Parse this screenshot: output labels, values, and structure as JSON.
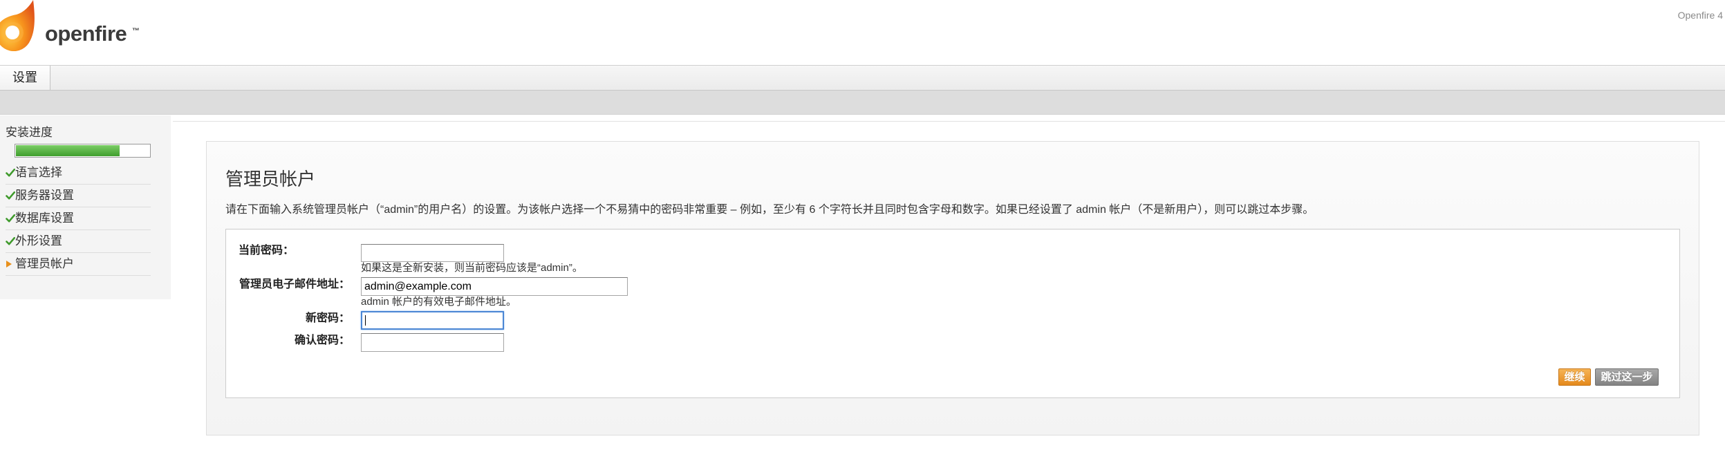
{
  "app": {
    "logo_text": "openfire",
    "logo_tm": "™",
    "version_text": "Openfire 4"
  },
  "tabs": [
    {
      "label": "设置"
    }
  ],
  "sidebar": {
    "progress_label": "安装进度",
    "progress_percent": 78,
    "steps": [
      {
        "label": "语言选择",
        "icon": "checkmark-icon"
      },
      {
        "label": "服务器设置",
        "icon": "checkmark-icon"
      },
      {
        "label": "数据库设置",
        "icon": "checkmark-icon"
      },
      {
        "label": "外形设置",
        "icon": "checkmark-icon"
      },
      {
        "label": "管理员帐户",
        "icon": "arrow-right-icon"
      }
    ]
  },
  "main": {
    "title": "管理员帐户",
    "description": "请在下面输入系统管理员帐户（“admin”的用户名）的设置。为该帐户选择一个不易猜中的密码非常重要 – 例如，至少有 6 个字符长并且同时包含字母和数字。如果已经设置了 admin 帐户（不是新用户），则可以跳过本步骤。",
    "form": {
      "current_password": {
        "label": "当前密码：",
        "value": "",
        "hint": "如果这是全新安装，则当前密码应该是“admin”。"
      },
      "email": {
        "label": "管理员电子邮件地址：",
        "value": "admin@example.com",
        "hint": "admin 帐户的有效电子邮件地址。"
      },
      "new_password": {
        "label": "新密码：",
        "value": ""
      },
      "confirm_password": {
        "label": "确认密码：",
        "value": ""
      }
    },
    "buttons": {
      "continue": "继续",
      "skip": "跳过这一步"
    }
  },
  "colors": {
    "brand_orange": "#f7941d",
    "progress_green": "#4aa83a",
    "continue_button": "#ec9a30",
    "skip_button": "#8f8f8f",
    "focus_blue": "#4a86d4"
  }
}
